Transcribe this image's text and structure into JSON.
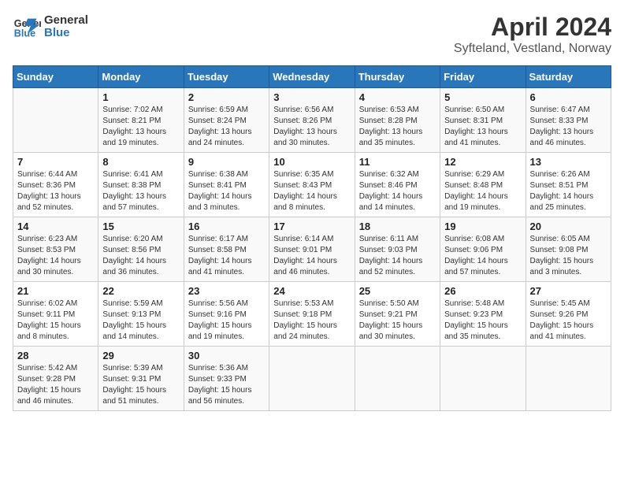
{
  "header": {
    "logo_line1": "General",
    "logo_line2": "Blue",
    "month": "April 2024",
    "location": "Syfteland, Vestland, Norway"
  },
  "weekdays": [
    "Sunday",
    "Monday",
    "Tuesday",
    "Wednesday",
    "Thursday",
    "Friday",
    "Saturday"
  ],
  "weeks": [
    [
      {
        "day": "",
        "info": ""
      },
      {
        "day": "1",
        "info": "Sunrise: 7:02 AM\nSunset: 8:21 PM\nDaylight: 13 hours\nand 19 minutes."
      },
      {
        "day": "2",
        "info": "Sunrise: 6:59 AM\nSunset: 8:24 PM\nDaylight: 13 hours\nand 24 minutes."
      },
      {
        "day": "3",
        "info": "Sunrise: 6:56 AM\nSunset: 8:26 PM\nDaylight: 13 hours\nand 30 minutes."
      },
      {
        "day": "4",
        "info": "Sunrise: 6:53 AM\nSunset: 8:28 PM\nDaylight: 13 hours\nand 35 minutes."
      },
      {
        "day": "5",
        "info": "Sunrise: 6:50 AM\nSunset: 8:31 PM\nDaylight: 13 hours\nand 41 minutes."
      },
      {
        "day": "6",
        "info": "Sunrise: 6:47 AM\nSunset: 8:33 PM\nDaylight: 13 hours\nand 46 minutes."
      }
    ],
    [
      {
        "day": "7",
        "info": "Sunrise: 6:44 AM\nSunset: 8:36 PM\nDaylight: 13 hours\nand 52 minutes."
      },
      {
        "day": "8",
        "info": "Sunrise: 6:41 AM\nSunset: 8:38 PM\nDaylight: 13 hours\nand 57 minutes."
      },
      {
        "day": "9",
        "info": "Sunrise: 6:38 AM\nSunset: 8:41 PM\nDaylight: 14 hours\nand 3 minutes."
      },
      {
        "day": "10",
        "info": "Sunrise: 6:35 AM\nSunset: 8:43 PM\nDaylight: 14 hours\nand 8 minutes."
      },
      {
        "day": "11",
        "info": "Sunrise: 6:32 AM\nSunset: 8:46 PM\nDaylight: 14 hours\nand 14 minutes."
      },
      {
        "day": "12",
        "info": "Sunrise: 6:29 AM\nSunset: 8:48 PM\nDaylight: 14 hours\nand 19 minutes."
      },
      {
        "day": "13",
        "info": "Sunrise: 6:26 AM\nSunset: 8:51 PM\nDaylight: 14 hours\nand 25 minutes."
      }
    ],
    [
      {
        "day": "14",
        "info": "Sunrise: 6:23 AM\nSunset: 8:53 PM\nDaylight: 14 hours\nand 30 minutes."
      },
      {
        "day": "15",
        "info": "Sunrise: 6:20 AM\nSunset: 8:56 PM\nDaylight: 14 hours\nand 36 minutes."
      },
      {
        "day": "16",
        "info": "Sunrise: 6:17 AM\nSunset: 8:58 PM\nDaylight: 14 hours\nand 41 minutes."
      },
      {
        "day": "17",
        "info": "Sunrise: 6:14 AM\nSunset: 9:01 PM\nDaylight: 14 hours\nand 46 minutes."
      },
      {
        "day": "18",
        "info": "Sunrise: 6:11 AM\nSunset: 9:03 PM\nDaylight: 14 hours\nand 52 minutes."
      },
      {
        "day": "19",
        "info": "Sunrise: 6:08 AM\nSunset: 9:06 PM\nDaylight: 14 hours\nand 57 minutes."
      },
      {
        "day": "20",
        "info": "Sunrise: 6:05 AM\nSunset: 9:08 PM\nDaylight: 15 hours\nand 3 minutes."
      }
    ],
    [
      {
        "day": "21",
        "info": "Sunrise: 6:02 AM\nSunset: 9:11 PM\nDaylight: 15 hours\nand 8 minutes."
      },
      {
        "day": "22",
        "info": "Sunrise: 5:59 AM\nSunset: 9:13 PM\nDaylight: 15 hours\nand 14 minutes."
      },
      {
        "day": "23",
        "info": "Sunrise: 5:56 AM\nSunset: 9:16 PM\nDaylight: 15 hours\nand 19 minutes."
      },
      {
        "day": "24",
        "info": "Sunrise: 5:53 AM\nSunset: 9:18 PM\nDaylight: 15 hours\nand 24 minutes."
      },
      {
        "day": "25",
        "info": "Sunrise: 5:50 AM\nSunset: 9:21 PM\nDaylight: 15 hours\nand 30 minutes."
      },
      {
        "day": "26",
        "info": "Sunrise: 5:48 AM\nSunset: 9:23 PM\nDaylight: 15 hours\nand 35 minutes."
      },
      {
        "day": "27",
        "info": "Sunrise: 5:45 AM\nSunset: 9:26 PM\nDaylight: 15 hours\nand 41 minutes."
      }
    ],
    [
      {
        "day": "28",
        "info": "Sunrise: 5:42 AM\nSunset: 9:28 PM\nDaylight: 15 hours\nand 46 minutes."
      },
      {
        "day": "29",
        "info": "Sunrise: 5:39 AM\nSunset: 9:31 PM\nDaylight: 15 hours\nand 51 minutes."
      },
      {
        "day": "30",
        "info": "Sunrise: 5:36 AM\nSunset: 9:33 PM\nDaylight: 15 hours\nand 56 minutes."
      },
      {
        "day": "",
        "info": ""
      },
      {
        "day": "",
        "info": ""
      },
      {
        "day": "",
        "info": ""
      },
      {
        "day": "",
        "info": ""
      }
    ]
  ]
}
